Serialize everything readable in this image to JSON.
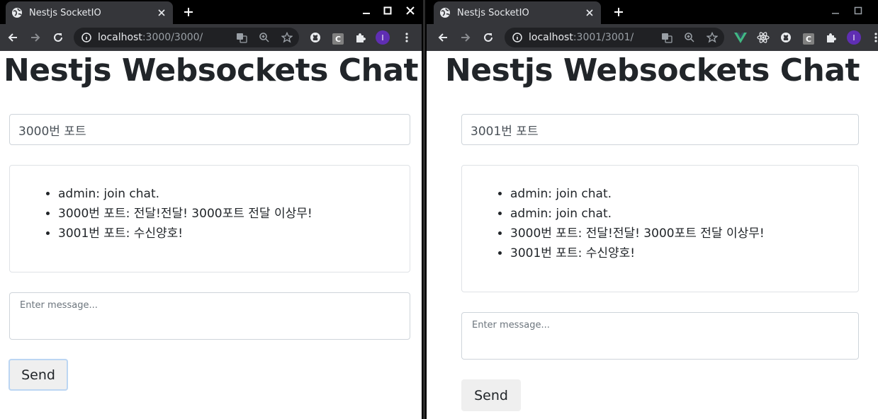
{
  "windows": [
    {
      "tab_title": "Nestjs SocketIO",
      "url_host": "localhost",
      "url_path": ":3000/3000/",
      "avatar_letter": "I",
      "heading": "Nestjs Websockets Chat",
      "name_value": "3000번 포트",
      "messages": [
        "admin: join chat.",
        "3000번 포트: 전달!전달! 3000포트 전달 이상무!",
        "3001번 포트: 수신양호!"
      ],
      "message_placeholder": "Enter message...",
      "send_label": "Send"
    },
    {
      "tab_title": "Nestjs SocketIO",
      "url_host": "localhost",
      "url_path": ":3001/3001/",
      "avatar_letter": "I",
      "heading": "Nestjs Websockets Chat",
      "name_value": "3001번 포트",
      "messages": [
        "admin: join chat.",
        "admin: join chat.",
        "3000번 포트: 전달!전달! 3000포트 전달 이상무!",
        "3001번 포트: 수신양호!"
      ],
      "message_placeholder": "Enter message...",
      "send_label": "Send"
    }
  ],
  "colors": {
    "tab_bg": "#35363a",
    "toolbar_bg": "#35363a",
    "omnibox_bg": "#202124",
    "avatar": "#5f2eb3",
    "vue_green": "#41b883",
    "heading_text": "#212529"
  },
  "icons": [
    "globe-icon",
    "close-icon",
    "plus-icon",
    "back-icon",
    "forward-icon",
    "reload-icon",
    "info-icon",
    "translate-icon",
    "zoom-icon",
    "star-icon",
    "github-icon",
    "c-extension-icon",
    "puzzle-icon",
    "vue-icon",
    "react-icon",
    "kebab-menu-icon",
    "minimize-icon",
    "maximize-icon"
  ]
}
